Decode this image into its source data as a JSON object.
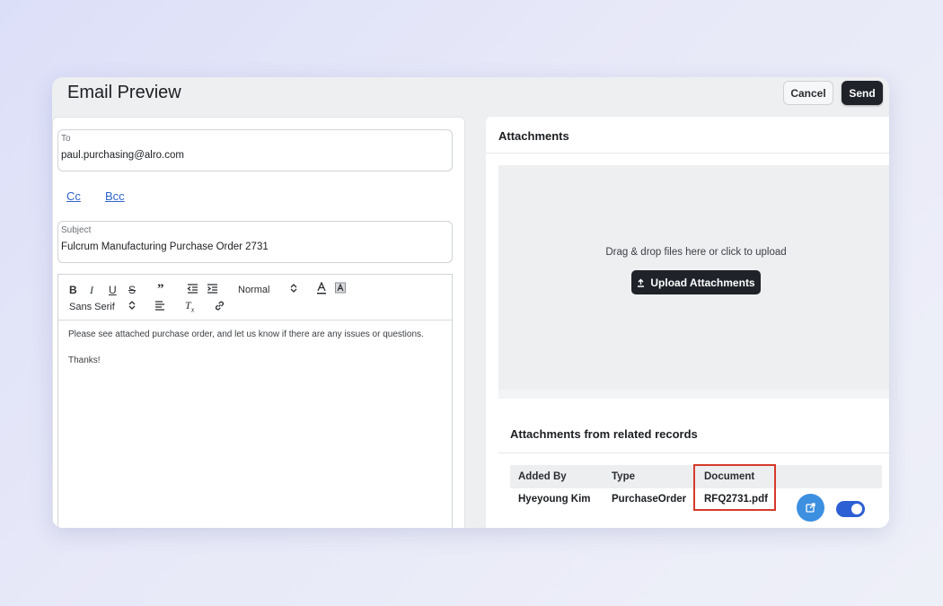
{
  "window": {
    "title": "Email Preview",
    "cancel_label": "Cancel",
    "send_label": "Send"
  },
  "compose": {
    "to_label": "To",
    "to_value": "paul.purchasing@alro.com",
    "cc_label": "Cc",
    "bcc_label": "Bcc",
    "subject_label": "Subject",
    "subject_value": "Fulcrum Manufacturing Purchase Order 2731",
    "toolbar": {
      "bold": "B",
      "italic": "I",
      "underline": "U",
      "strike": "S",
      "blockquote": "”",
      "size_value": "Normal",
      "font_value": "Sans Serif",
      "clear_format": "T",
      "clear_format_sub": "x"
    },
    "body_lines": [
      "Please see attached purchase order, and let us know if there are any issues or questions.",
      "Thanks!"
    ]
  },
  "attachments": {
    "title": "Attachments",
    "dropzone_text": "Drag & drop files here or click to upload",
    "upload_label": "Upload Attachments",
    "related_title": "Attachments from related records",
    "columns": [
      "Added By",
      "Type",
      "Document"
    ],
    "rows": [
      {
        "added_by": "Hyeyoung Kim",
        "type": "PurchaseOrder",
        "document": "RFQ2731.pdf",
        "enabled": true
      }
    ]
  },
  "colors": {
    "primary_dark": "#1f2329",
    "link": "#2f63c8",
    "highlight": "#d63a2a",
    "toggle_on": "#2c5fd4",
    "open_button": "#3d8fe0"
  },
  "icons": [
    "bold-icon",
    "italic-icon",
    "underline-icon",
    "strikethrough-icon",
    "blockquote-icon",
    "outdent-icon",
    "indent-icon",
    "select-arrows-icon",
    "font-color-icon",
    "highlight-color-icon",
    "align-icon",
    "clear-format-icon",
    "link-icon",
    "upload-icon",
    "external-link-icon"
  ]
}
